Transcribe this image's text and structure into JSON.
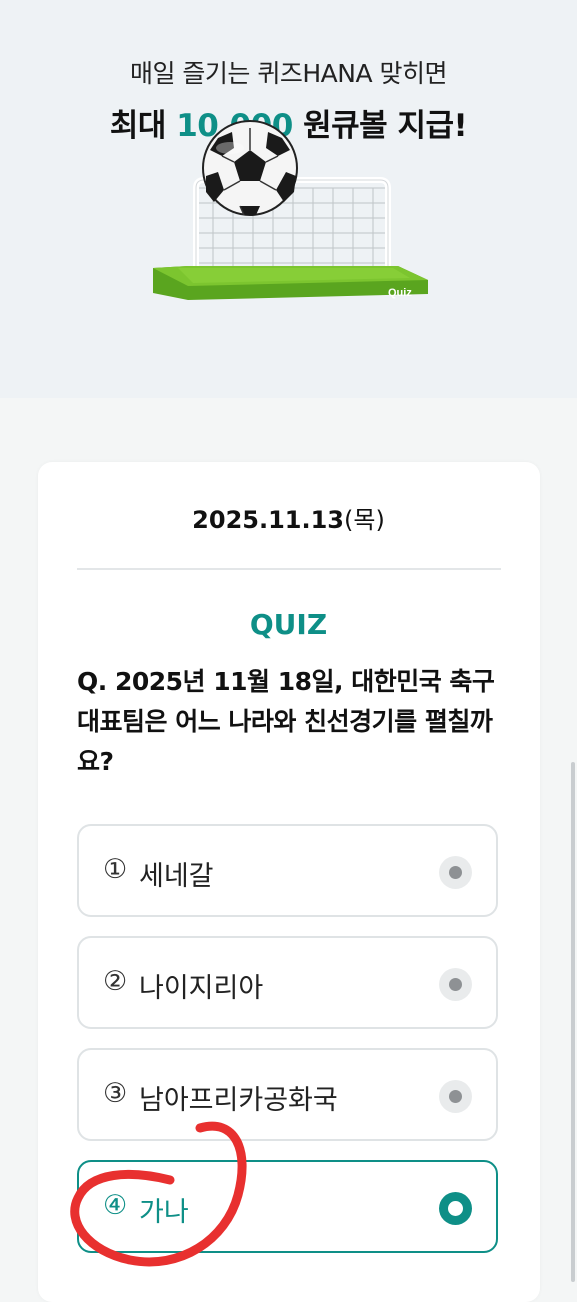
{
  "hero": {
    "subtitle": "매일 즐기는 퀴즈HANA 맞히면",
    "title_prefix": "최대 ",
    "title_amount": "10,000",
    "title_suffix": " 원큐볼 지급!",
    "goal_badge": "Quiz"
  },
  "card": {
    "date": "2025.11.13",
    "day_of_week": "(목)",
    "quiz_label": "QUIZ",
    "question": "Q. 2025년 11월 18일, 대한민국 축구 대표팀은 어느 나라와 친선경기를 펼칠까요?",
    "options": [
      {
        "number": "①",
        "label": "세네갈",
        "selected": false
      },
      {
        "number": "②",
        "label": "나이지리아",
        "selected": false
      },
      {
        "number": "③",
        "label": "남아프리카공화국",
        "selected": false
      },
      {
        "number": "④",
        "label": "가나",
        "selected": true
      }
    ]
  },
  "colors": {
    "accent": "#0e8f87",
    "hero_bg": "#eef2f5",
    "page_bg": "#f4f6f6",
    "annotation": "#e8302f"
  }
}
